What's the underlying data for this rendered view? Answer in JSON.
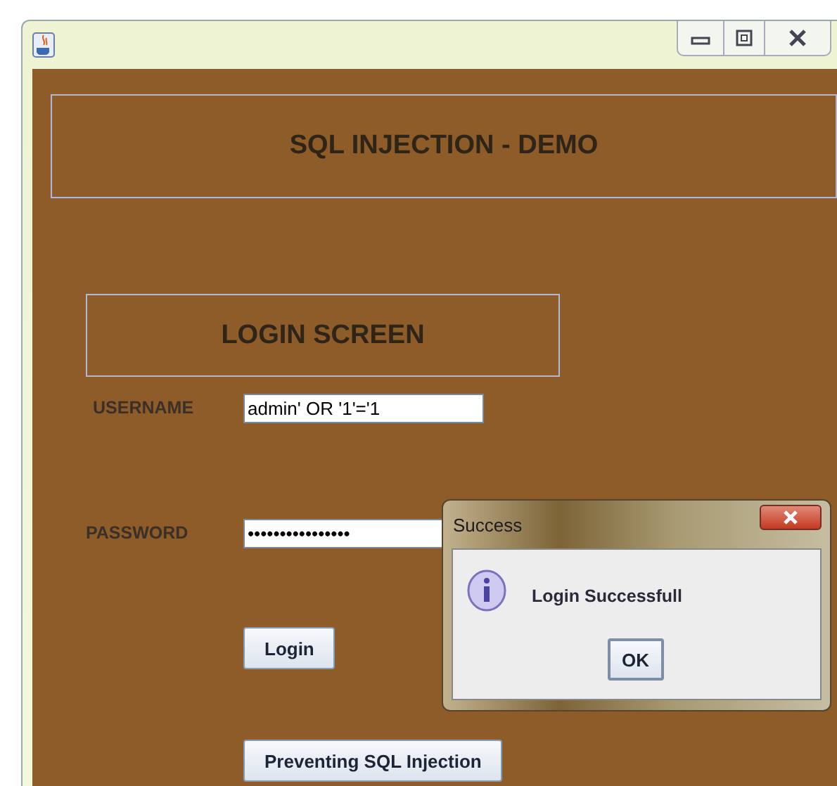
{
  "header": {
    "title": "SQL INJECTION - DEMO"
  },
  "login_panel": {
    "title": "LOGIN SCREEN"
  },
  "fields": [
    {
      "label": "USERNAME",
      "value": "admin' OR '1'='1"
    },
    {
      "label": "PASSWORD",
      "value": "••••••••••••••••"
    }
  ],
  "buttons": [
    {
      "label": "Login"
    },
    {
      "label": "Preventing SQL Injection"
    }
  ],
  "dialog": {
    "title": "Success",
    "message": "Login Successfull",
    "button": "OK"
  }
}
